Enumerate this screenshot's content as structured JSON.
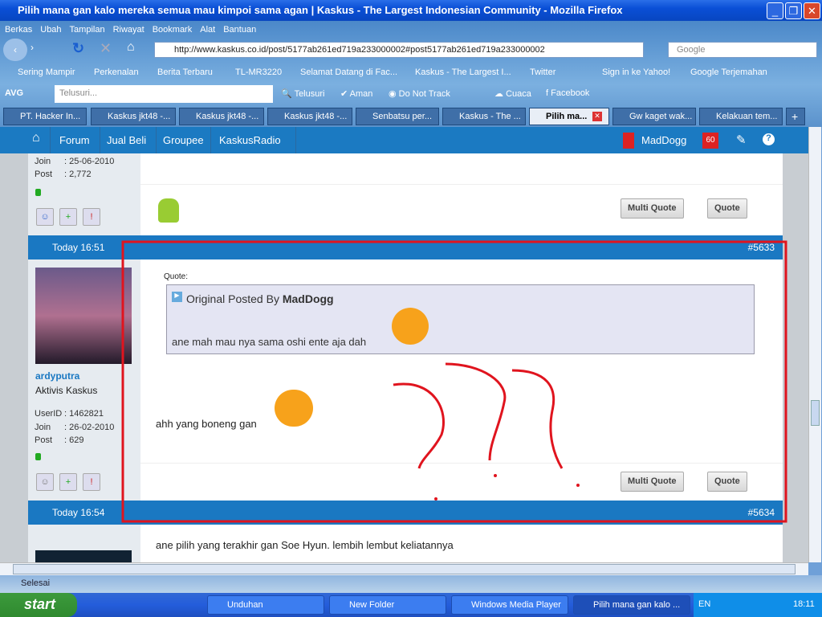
{
  "window": {
    "title": "Pilih mana gan kalo mereka semua mau kimpoi sama agan | Kaskus - The Largest Indonesian Community - Mozilla Firefox"
  },
  "menu": [
    "Berkas",
    "Ubah",
    "Tampilan",
    "Riwayat",
    "Bookmark",
    "Alat",
    "Bantuan"
  ],
  "url": "http://www.kaskus.co.id/post/5177ab261ed719a233000002#post5177ab261ed719a233000002",
  "search_placeholder": "Google",
  "bookmarks": [
    "Sering Mampir",
    "Perkenalan",
    "Berita Terbaru",
    "TL-MR3220",
    "Selamat Datang di Fac...",
    "Kaskus - The Largest I...",
    "Twitter",
    "Sign in ke Yahoo!",
    "Google Terjemahan"
  ],
  "avg": {
    "brand": "AVG",
    "search_placeholder": "Telusuri...",
    "search_btn": "Telusuri",
    "items": [
      "Aman",
      "Do Not Track",
      "Cuaca",
      "Facebook"
    ]
  },
  "tabs": [
    "PT. Hacker In...",
    "Kaskus jkt48 -...",
    "Kaskus jkt48 -...",
    "Kaskus jkt48 -...",
    "Senbatsu per...",
    "Kaskus - The ...",
    "Pilih ma...",
    "Gw kaget wak...",
    "Kelakuan tem..."
  ],
  "kaskus_nav": {
    "items": [
      "Forum",
      "Jual Beli",
      "Groupee",
      "KaskusRadio"
    ],
    "user": "MadDogg",
    "notif": "60"
  },
  "prev_post": {
    "join_label": "Join",
    "join": ": 25-06-2010",
    "post_label": "Post",
    "post": ": 2,772"
  },
  "buttons": {
    "multi_quote": "Multi Quote",
    "quote": "Quote"
  },
  "post1": {
    "time": "Today 16:51",
    "number": "#5633",
    "username": "ardyputra",
    "rank": "Aktivis Kaskus",
    "userid_label": "UserID",
    "userid": ": 1462821",
    "join_label": "Join",
    "join": ": 26-02-2010",
    "post_label": "Post",
    "post": ": 629",
    "quote_label": "Quote:",
    "quote_prefix": "Original Posted By",
    "quote_author": "MadDogg",
    "quote_text": "ane mah mau nya sama oshi ente aja dah",
    "body": "ahh yang boneng gan"
  },
  "post2": {
    "time": "Today 16:54",
    "number": "#5634",
    "body": "ane pilih yang terakhir gan Soe Hyun. lembih lembut keliatannya"
  },
  "status": "Selesai",
  "taskbar": {
    "start": "start",
    "items": [
      "Unduhan",
      "New Folder",
      "Windows Media Player",
      "Pilih mana gan kalo ..."
    ],
    "lang": "EN",
    "clock": "18:11"
  },
  "colors": {
    "kaskus_blue": "#1b7ac2",
    "annotation_red": "#e0141e"
  }
}
